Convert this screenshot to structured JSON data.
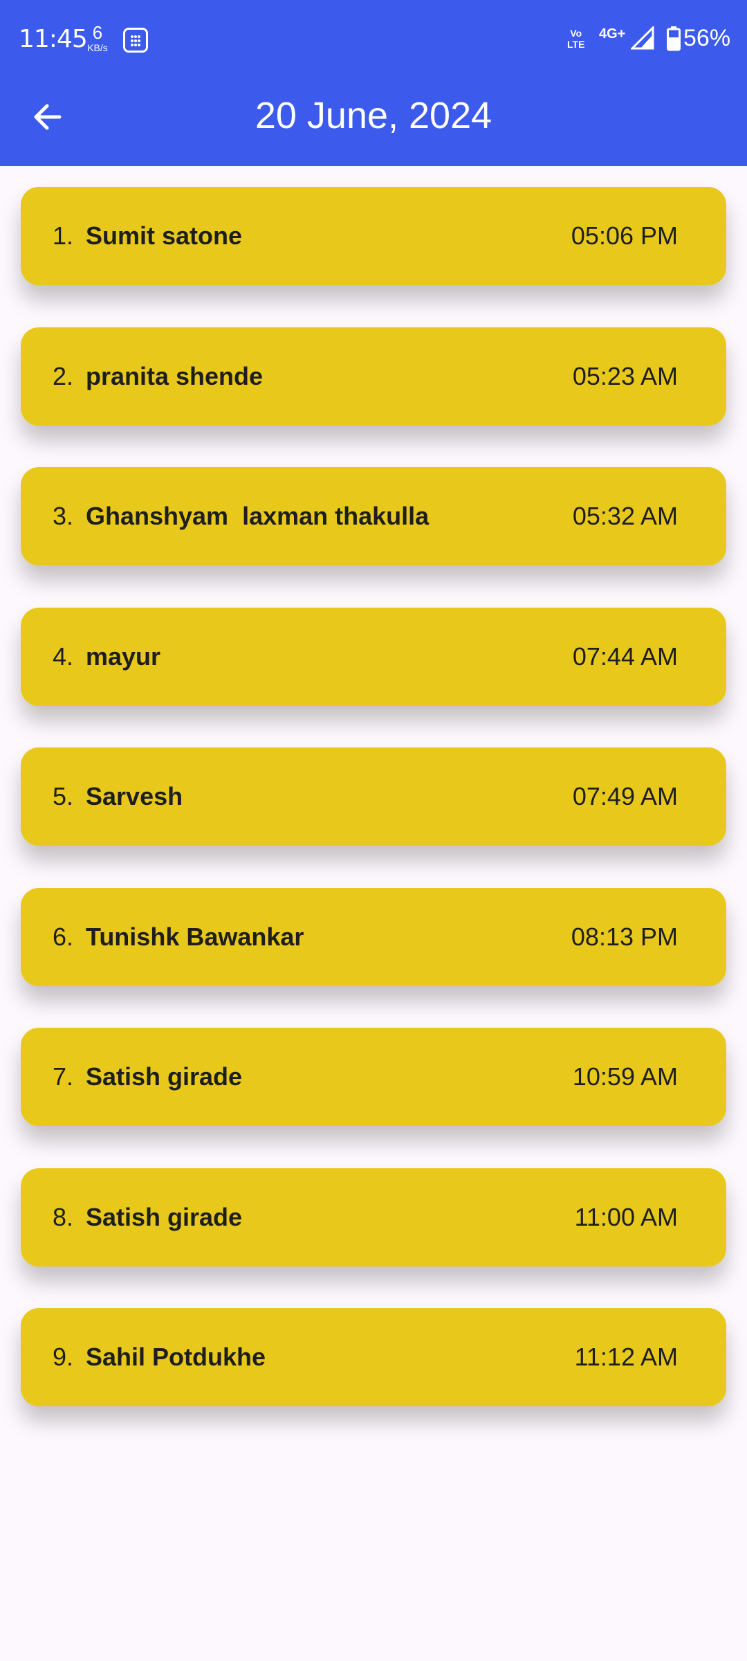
{
  "status_bar": {
    "time": "11:45",
    "net_speed_value": "6",
    "net_speed_unit": "KB/s",
    "volte_top": "Vo",
    "volte_bottom": "LTE",
    "network_type": "4G+",
    "battery_percent": "56%",
    "icons": [
      "calculator-icon",
      "signal-icon",
      "battery-icon"
    ]
  },
  "header": {
    "title": "20 June, 2024",
    "back_icon": "arrow-left-icon",
    "color": "#3c5aec"
  },
  "entries": [
    {
      "index": "1.",
      "name": "Sumit satone",
      "time": "05:06 PM"
    },
    {
      "index": "2.",
      "name": "pranita shende",
      "time": "05:23 AM"
    },
    {
      "index": "3.",
      "name": "Ghanshyam  laxman thakulla",
      "time": "05:32 AM"
    },
    {
      "index": "4.",
      "name": "mayur",
      "time": "07:44 AM"
    },
    {
      "index": "5.",
      "name": "Sarvesh",
      "time": "07:49 AM"
    },
    {
      "index": "6.",
      "name": "Tunishk Bawankar",
      "time": "08:13 PM"
    },
    {
      "index": "7.",
      "name": "Satish girade",
      "time": "10:59 AM"
    },
    {
      "index": "8.",
      "name": "Satish girade",
      "time": "11:00 AM"
    },
    {
      "index": "9.",
      "name": "Sahil Potdukhe",
      "time": "11:12 AM"
    }
  ],
  "card_color": "#e8c91b"
}
